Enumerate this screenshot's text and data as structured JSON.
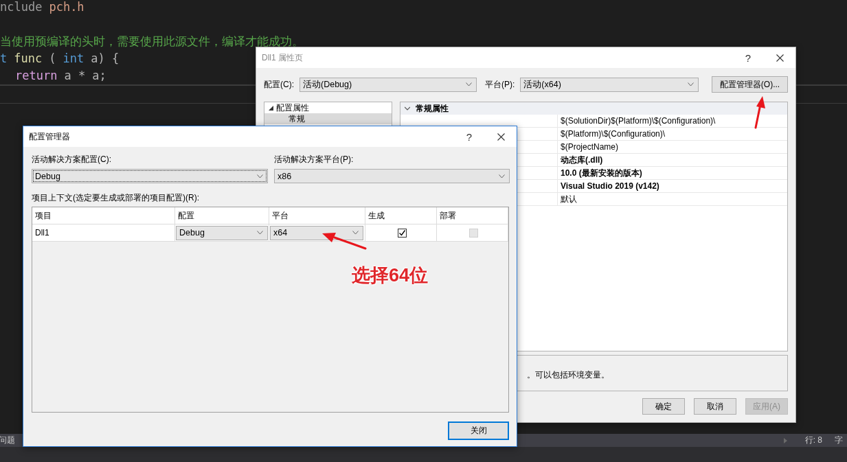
{
  "editor": {
    "lines": [
      {
        "indent": false,
        "tokens": [
          {
            "kind": "preprocessor",
            "text": "nclude"
          },
          {
            "kind": "string",
            "text": "pch.h"
          }
        ]
      },
      {
        "indent": false,
        "blank_before": true,
        "tokens": [
          {
            "kind": "comment",
            "text": "当使用预编译的头时，需要使用此源文件，编译才能成功。"
          }
        ]
      },
      {
        "indent": false,
        "tokens": [
          {
            "kind": "keyword",
            "text": "t"
          },
          {
            "kind": "function",
            "text": "func"
          },
          {
            "kind": "plain",
            "text": "("
          },
          {
            "kind": "keyword",
            "text": "int"
          },
          {
            "kind": "plain",
            "text": "a) {"
          }
        ]
      },
      {
        "indent": true,
        "tokens": [
          {
            "kind": "control",
            "text": "return"
          },
          {
            "kind": "plain",
            "text": "a * a;"
          }
        ]
      }
    ]
  },
  "status_bar": {
    "left": "问题",
    "position": "行: 8",
    "column": "字"
  },
  "properties_window": {
    "title": "Dll1 属性页",
    "help": "?",
    "config_label": "配置(C):",
    "config_value": "活动(Debug)",
    "platform_label": "平台(P):",
    "platform_value": "活动(x64)",
    "manager_button": "配置管理器(O)...",
    "tree": [
      {
        "label": "配置属性",
        "expanded": true,
        "selected": false,
        "children": [
          {
            "label": "常规",
            "selected": true
          }
        ]
      }
    ],
    "category": {
      "label": "常规属性",
      "expanded": true
    },
    "rows": [
      {
        "value": "$(SolutionDir)$(Platform)\\$(Configuration)\\",
        "modified": false
      },
      {
        "value": "$(Platform)\\$(Configuration)\\",
        "modified": false
      },
      {
        "value": "$(ProjectName)",
        "modified": false
      },
      {
        "value": "动态库(.dll)",
        "modified": true
      },
      {
        "value": "10.0 (最新安装的版本)",
        "modified": true
      },
      {
        "value": "Visual Studio 2019 (v142)",
        "modified": true
      },
      {
        "value": "默认",
        "modified": false
      }
    ],
    "description": "。可以包括环境变量。",
    "buttons": [
      {
        "label": "确定",
        "disabled": false
      },
      {
        "label": "取消",
        "disabled": false
      },
      {
        "label": "应用(A)",
        "disabled": true
      }
    ]
  },
  "config_manager": {
    "title": "配置管理器",
    "help": "?",
    "solution_config_label": "活动解决方案配置(C):",
    "solution_config_value": "Debug",
    "solution_platform_label": "活动解决方案平台(P):",
    "solution_platform_value": "x86",
    "context_label": "项目上下文(选定要生成或部署的项目配置)(R):",
    "columns": [
      "项目",
      "配置",
      "平台",
      "生成",
      "部署"
    ],
    "rows": [
      {
        "project": "Dll1",
        "configuration": "Debug",
        "platform": "x64",
        "build": {
          "checked": true,
          "disabled": false
        },
        "deploy": {
          "checked": false,
          "disabled": true
        }
      }
    ],
    "close_button": "关闭"
  },
  "annotation": {
    "label": "选择64位"
  }
}
